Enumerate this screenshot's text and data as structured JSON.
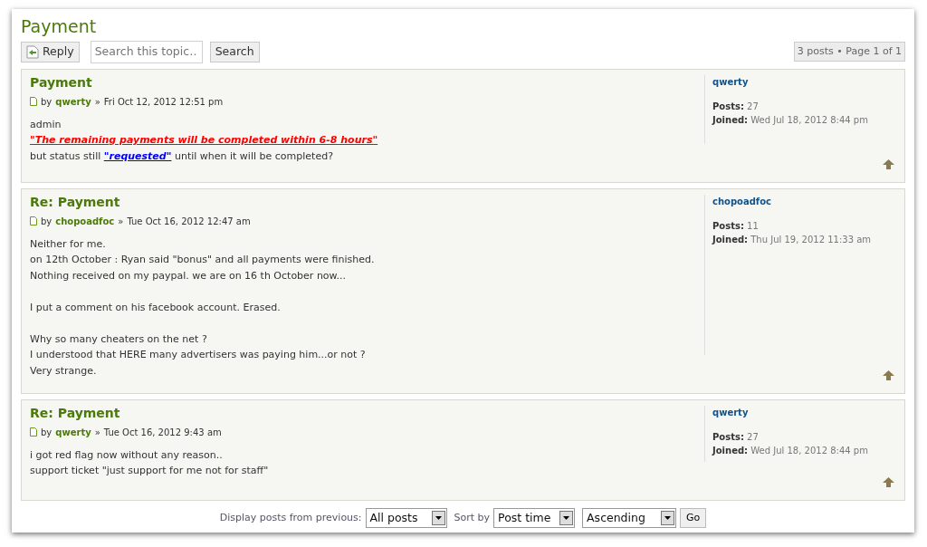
{
  "topic_title": "Payment",
  "toolbar": {
    "reply_button": "Reply",
    "search": {
      "placeholder": "Search this topic…"
    },
    "search_button": "Search",
    "pagination": "3 posts • Page 1 of 1"
  },
  "posts": [
    {
      "title": "Payment",
      "by": "by",
      "author": "qwerty",
      "separator": "»",
      "date": "Fri Oct 12, 2012 12:51 pm",
      "paragraphs": [
        [
          [
            {
              "kind": "plain",
              "text": "admin"
            }
          ],
          [
            {
              "kind": "link",
              "text": "\"The remaining payments will be completed within 6-8 hours\"",
              "color": "#ff0000"
            }
          ],
          [
            {
              "kind": "plain",
              "text": "but status still "
            },
            {
              "kind": "link",
              "text": "\"requested\"",
              "color": "#0000ff"
            },
            {
              "kind": "plain",
              "text": " until when it will be completed?"
            }
          ]
        ]
      ],
      "profile": {
        "name": "qwerty",
        "posts_label": "Posts:",
        "posts": "27",
        "joined_label": "Joined:",
        "joined": "Wed Jul 18, 2012 8:44 pm"
      }
    },
    {
      "title": "Re: Payment",
      "by": "by",
      "author": "chopoadfoc",
      "separator": "»",
      "date": "Tue Oct 16, 2012 12:47 am",
      "paragraphs": [
        [
          [
            {
              "kind": "plain",
              "text": "Neither for me."
            }
          ],
          [
            {
              "kind": "plain",
              "text": "on 12th October : Ryan said \"bonus\" and all payments were finished."
            }
          ],
          [
            {
              "kind": "plain",
              "text": "Nothing received on my paypal. we are on 16 th October now..."
            }
          ]
        ],
        [
          [
            {
              "kind": "plain",
              "text": "I put a comment on his facebook account. Erased."
            }
          ]
        ],
        [
          [
            {
              "kind": "plain",
              "text": "Why so many cheaters on the net ?"
            }
          ],
          [
            {
              "kind": "plain",
              "text": "I understood that HERE many advertisers was paying him...or not ?"
            }
          ],
          [
            {
              "kind": "plain",
              "text": "Very strange."
            }
          ]
        ]
      ],
      "profile": {
        "name": "chopoadfoc",
        "posts_label": "Posts:",
        "posts": "11",
        "joined_label": "Joined:",
        "joined": "Thu Jul 19, 2012 11:33 am"
      }
    },
    {
      "title": "Re: Payment",
      "by": "by",
      "author": "qwerty",
      "separator": "»",
      "date": "Tue Oct 16, 2012 9:43 am",
      "paragraphs": [
        [
          [
            {
              "kind": "plain",
              "text": "i got red flag now without any reason.."
            }
          ],
          [
            {
              "kind": "plain",
              "text": "support ticket \"just support for me not for staff\""
            }
          ]
        ]
      ],
      "profile": {
        "name": "qwerty",
        "posts_label": "Posts:",
        "posts": "27",
        "joined_label": "Joined:",
        "joined": "Wed Jul 18, 2012 8:44 pm"
      }
    }
  ],
  "footer": {
    "display_label": "Display posts from previous:",
    "display_value": "All posts",
    "sort_label": "Sort by",
    "sort_value": "Post time",
    "order_value": "Ascending",
    "go_button": "Go"
  }
}
